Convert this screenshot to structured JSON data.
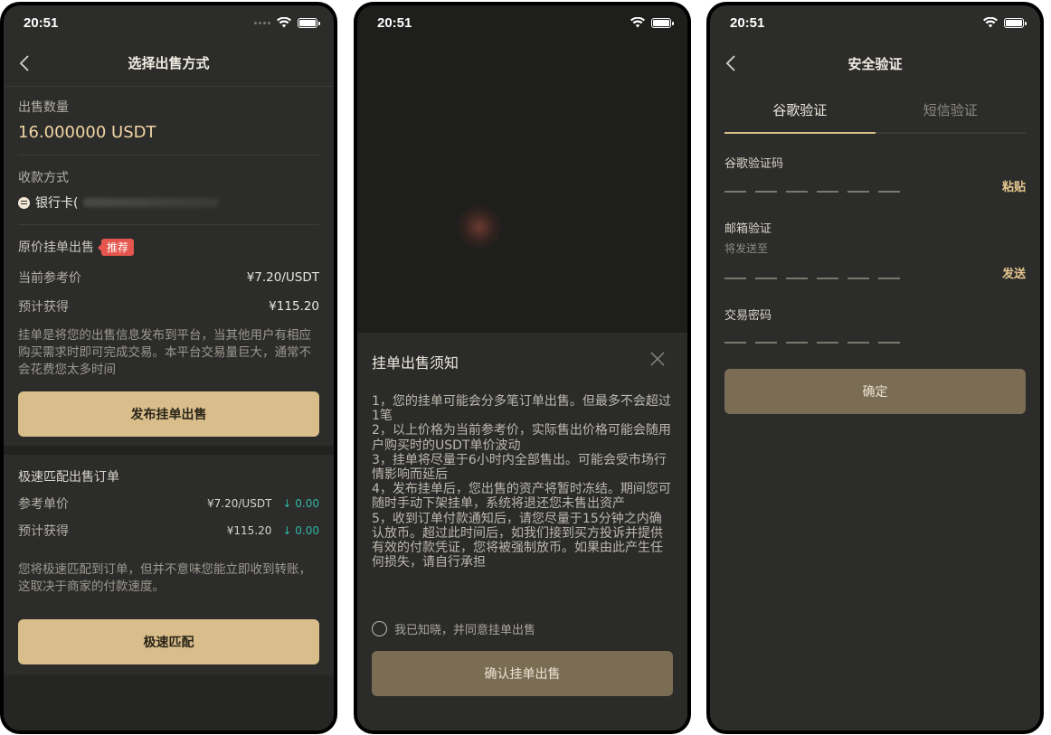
{
  "status": {
    "time": "20:51"
  },
  "screen1": {
    "title": "选择出售方式",
    "sell_qty_label": "出售数量",
    "sell_qty_value": "16.000000 USDT",
    "payment_label": "收款方式",
    "payment_value": "银行卡(",
    "listing_label": "原价挂单出售",
    "recommend_badge": "推荐",
    "ref_price_label": "当前参考价",
    "ref_price_value": "¥7.20/USDT",
    "expected_label": "预计获得",
    "expected_value": "¥115.20",
    "listing_desc": "挂单是将您的出售信息发布到平台，当其他用户有相应购买需求时即可完成交易。本平台交易量巨大，通常不会花费您太多时间",
    "publish_button": "发布挂单出售",
    "quick_title": "极速匹配出售订单",
    "quick_ref_label": "参考单价",
    "quick_ref_value": "¥7.20/USDT",
    "quick_ref_change": "↓ 0.00",
    "quick_exp_label": "预计获得",
    "quick_exp_value": "¥115.20",
    "quick_exp_change": "↓ 0.00",
    "quick_desc": "您将极速匹配到订单，但并不意味您能立即收到转账，这取决于商家的付款速度。",
    "quick_button": "极速匹配"
  },
  "screen2": {
    "sheet_title": "挂单出售须知",
    "notice": [
      "1，您的挂单可能会分多笔订单出售。但最多不会超过1笔",
      "2，以上价格为当前参考价，实际售出价格可能会随用户购买时的USDT单价波动",
      "3，挂单将尽量于6小时内全部售出。可能会受市场行情影响而延后",
      "4，发布挂单后，您出售的资产将暂时冻结。期间您可随时手动下架挂单，系统将退还您未售出资产",
      "5，收到订单付款通知后，请您尽量于15分钟之内确认放币。超过此时间后，如我们接到买方投诉并提供有效的付款凭证，您将被强制放币。如果由此产生任何损失，请自行承担"
    ],
    "agree_text": "我已知晓，并同意挂单出售",
    "confirm_button": "确认挂单出售"
  },
  "screen3": {
    "title": "安全验证",
    "tab_google": "谷歌验证",
    "tab_sms": "短信验证",
    "google_label": "谷歌验证码",
    "paste_button": "粘贴",
    "email_label": "邮箱验证",
    "email_sub": "将发送至",
    "send_button": "发送",
    "password_label": "交易密码",
    "confirm_button": "确定"
  },
  "colors": {
    "accent": "#d9be8b",
    "up_down": "#2fb8a6",
    "badge": "#e4564e",
    "bg": "#2c2c2a"
  }
}
